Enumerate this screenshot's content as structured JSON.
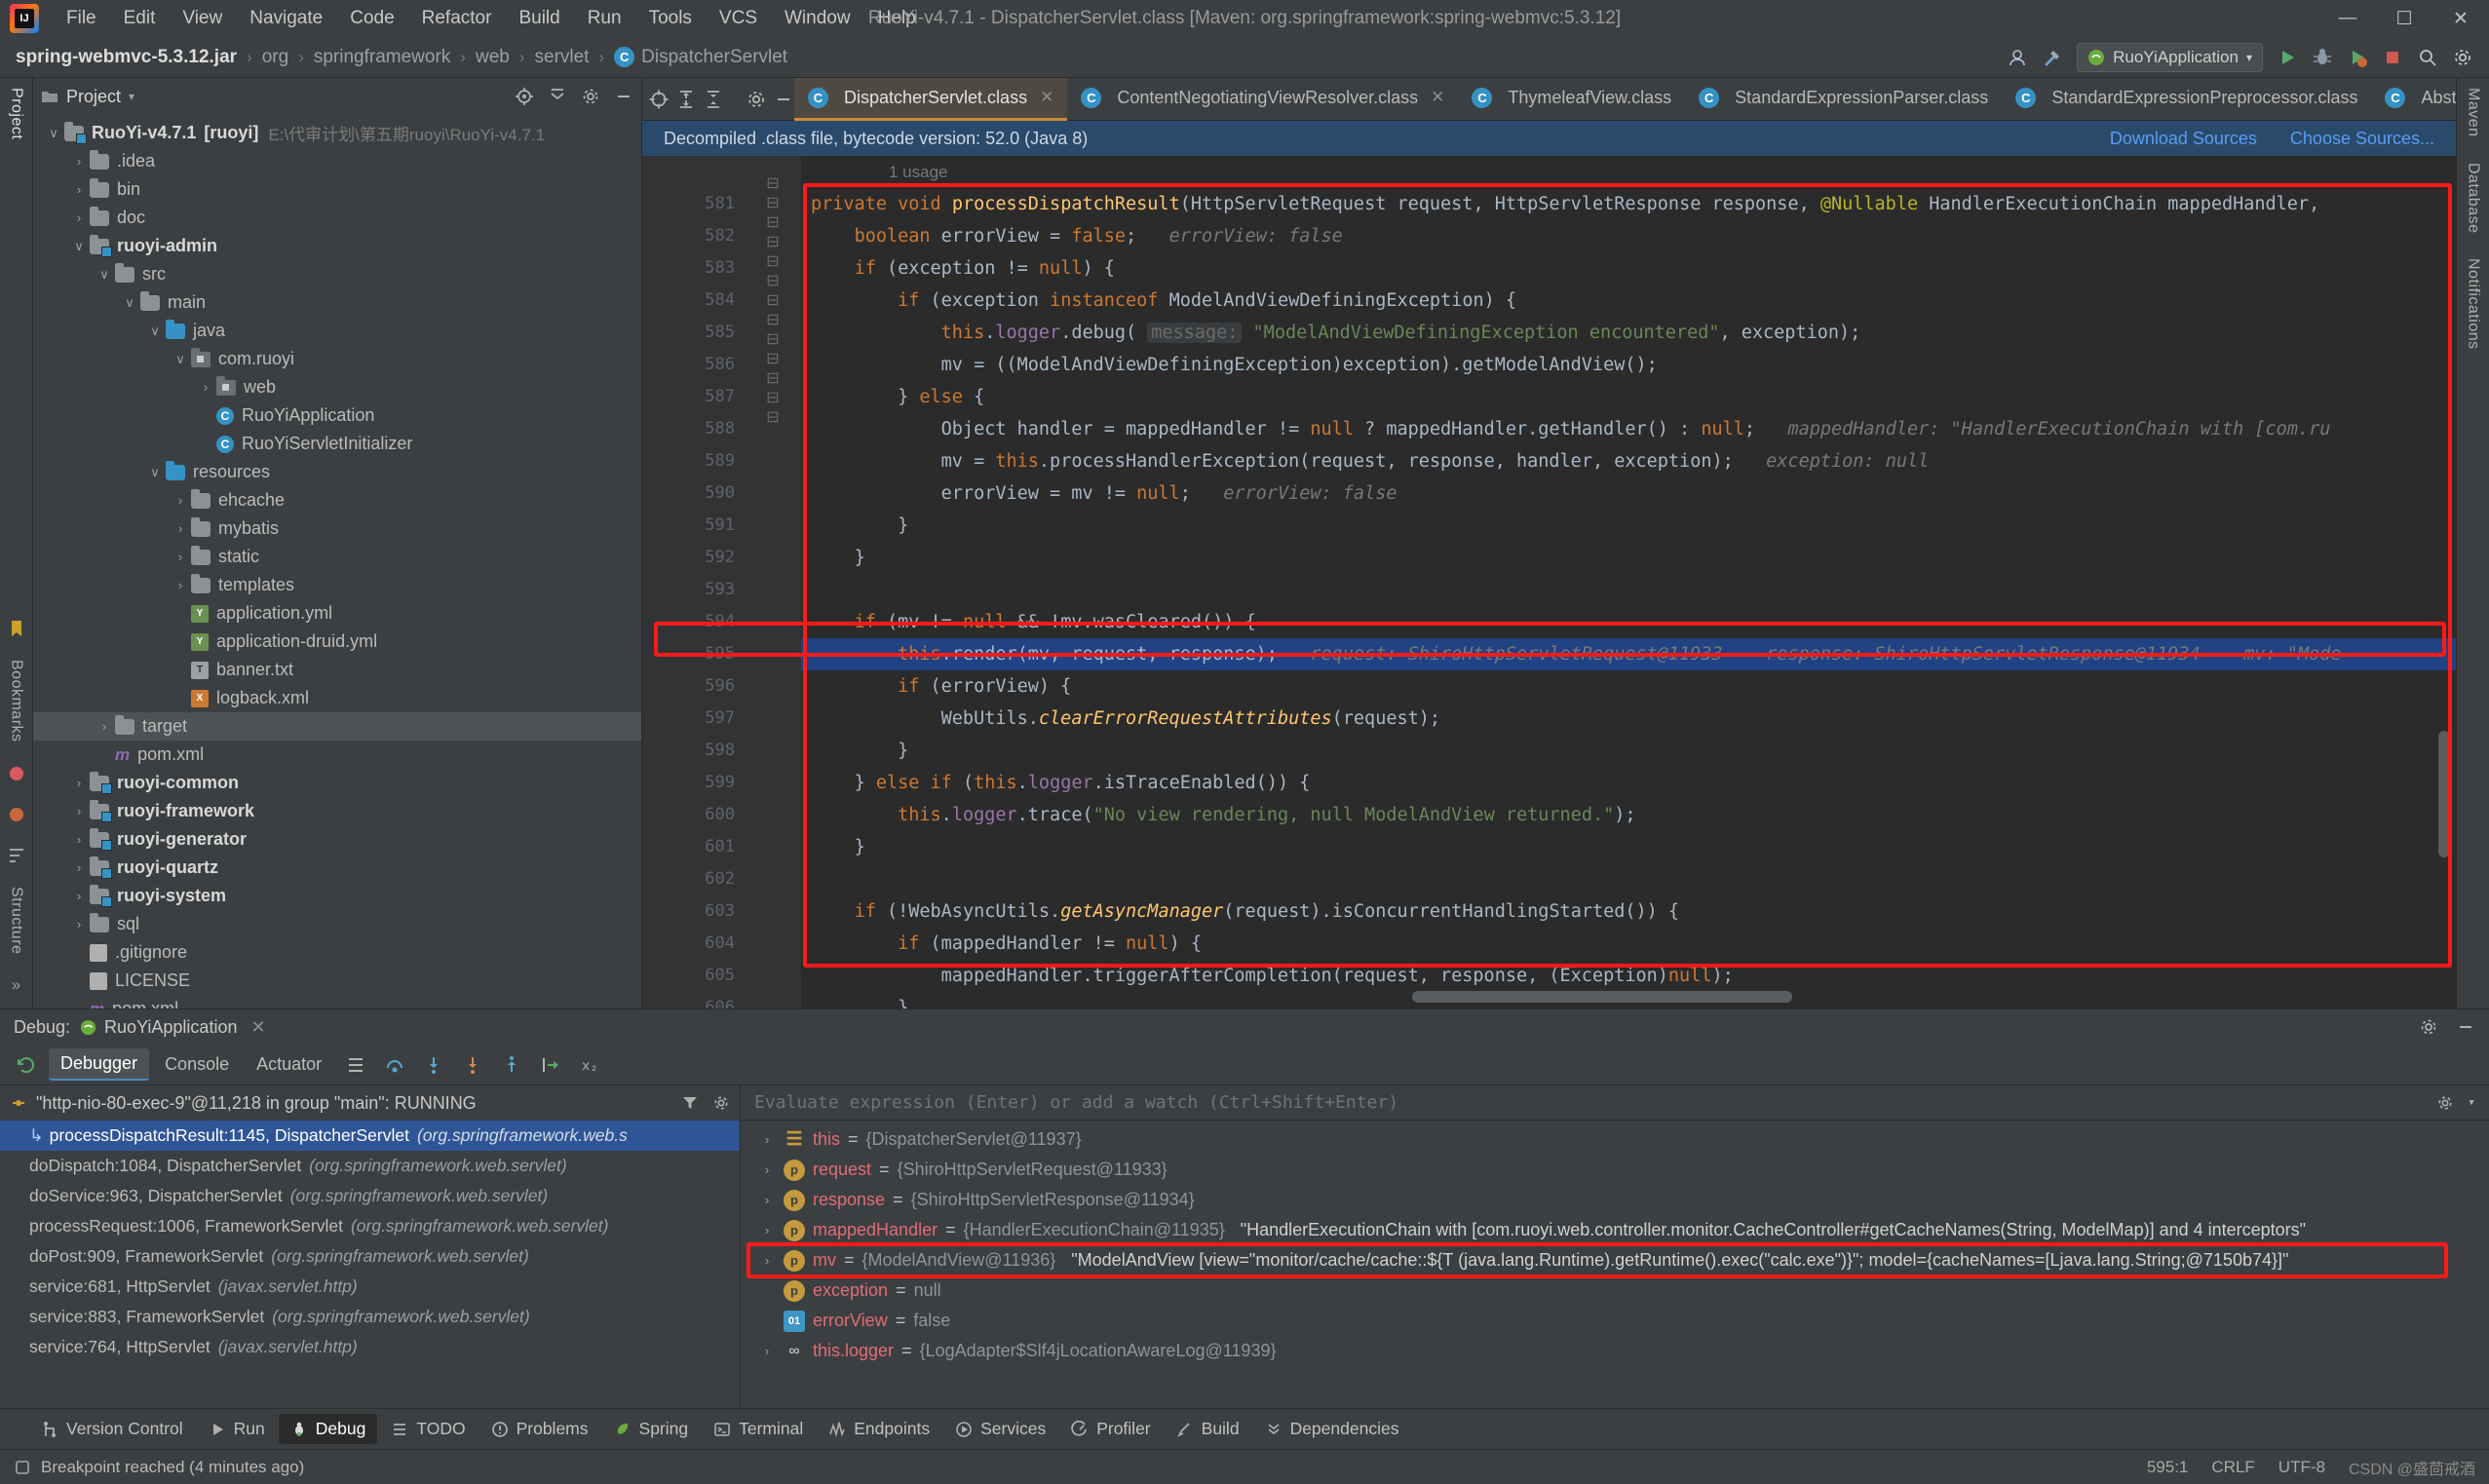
{
  "window": {
    "title": "RuoYi-v4.7.1 - DispatcherServlet.class [Maven: org.springframework:spring-webmvc:5.3.12]",
    "minimize": "—",
    "maximize": "☐",
    "close": "✕"
  },
  "menu": [
    {
      "label": "File"
    },
    {
      "label": "Edit"
    },
    {
      "label": "View"
    },
    {
      "label": "Navigate"
    },
    {
      "label": "Code"
    },
    {
      "label": "Refactor"
    },
    {
      "label": "Build"
    },
    {
      "label": "Run"
    },
    {
      "label": "Tools"
    },
    {
      "label": "VCS"
    },
    {
      "label": "Window"
    },
    {
      "label": "Help"
    }
  ],
  "breadcrumb": {
    "items": [
      "spring-webmvc-5.3.12.jar",
      "org",
      "springframework",
      "web",
      "servlet",
      "DispatcherServlet"
    ],
    "class_badge": "C",
    "separator": "›"
  },
  "navbar_right": {
    "run_config": "RuoYiApplication",
    "icons": [
      "user-icon",
      "hammer-icon",
      "run-icon",
      "debug-icon",
      "coverage-icon",
      "stop-icon",
      "search-icon",
      "settings-icon"
    ]
  },
  "left_strip": {
    "top": [
      "Project"
    ],
    "bottom": [
      "Bookmarks",
      "Structure"
    ]
  },
  "right_strip": {
    "items": [
      "Maven",
      "Database",
      "Notifications"
    ]
  },
  "project_panel": {
    "title": "Project",
    "header_icons": [
      "target-icon",
      "collapse-icon",
      "settings-icon",
      "hide-icon"
    ],
    "tree": [
      {
        "indent": 0,
        "arrow": "∨",
        "icon": "module",
        "label": "RuoYi-v4.7.1",
        "bold_suffix": "[ruoyi]",
        "path": "E:\\代审计划\\第五期ruoyi\\RuoYi-v4.7.1",
        "bold": true,
        "selected": false
      },
      {
        "indent": 1,
        "arrow": "›",
        "icon": "folder",
        "label": ".idea"
      },
      {
        "indent": 1,
        "arrow": "›",
        "icon": "folder",
        "label": "bin"
      },
      {
        "indent": 1,
        "arrow": "›",
        "icon": "folder",
        "label": "doc"
      },
      {
        "indent": 1,
        "arrow": "∨",
        "icon": "module",
        "label": "ruoyi-admin",
        "bold": true
      },
      {
        "indent": 2,
        "arrow": "∨",
        "icon": "folder",
        "label": "src"
      },
      {
        "indent": 3,
        "arrow": "∨",
        "icon": "folder",
        "label": "main"
      },
      {
        "indent": 4,
        "arrow": "∨",
        "icon": "source",
        "label": "java"
      },
      {
        "indent": 5,
        "arrow": "∨",
        "icon": "package",
        "label": "com.ruoyi"
      },
      {
        "indent": 6,
        "arrow": "›",
        "icon": "package",
        "label": "web"
      },
      {
        "indent": 6,
        "arrow": "",
        "icon": "class",
        "label": "RuoYiApplication"
      },
      {
        "indent": 6,
        "arrow": "",
        "icon": "class",
        "label": "RuoYiServletInitializer"
      },
      {
        "indent": 4,
        "arrow": "∨",
        "icon": "source",
        "label": "resources"
      },
      {
        "indent": 5,
        "arrow": "›",
        "icon": "folder",
        "label": "ehcache"
      },
      {
        "indent": 5,
        "arrow": "›",
        "icon": "folder",
        "label": "mybatis"
      },
      {
        "indent": 5,
        "arrow": "›",
        "icon": "folder",
        "label": "static"
      },
      {
        "indent": 5,
        "arrow": "›",
        "icon": "folder",
        "label": "templates"
      },
      {
        "indent": 5,
        "arrow": "",
        "icon": "yml",
        "label": "application.yml"
      },
      {
        "indent": 5,
        "arrow": "",
        "icon": "yml",
        "label": "application-druid.yml"
      },
      {
        "indent": 5,
        "arrow": "",
        "icon": "txt",
        "label": "banner.txt"
      },
      {
        "indent": 5,
        "arrow": "",
        "icon": "xml",
        "label": "logback.xml"
      },
      {
        "indent": 2,
        "arrow": "›",
        "icon": "folder",
        "label": "target",
        "selected": true
      },
      {
        "indent": 2,
        "arrow": "",
        "icon": "maven",
        "label": "pom.xml"
      },
      {
        "indent": 1,
        "arrow": "›",
        "icon": "module",
        "label": "ruoyi-common",
        "bold": true
      },
      {
        "indent": 1,
        "arrow": "›",
        "icon": "module",
        "label": "ruoyi-framework",
        "bold": true
      },
      {
        "indent": 1,
        "arrow": "›",
        "icon": "module",
        "label": "ruoyi-generator",
        "bold": true
      },
      {
        "indent": 1,
        "arrow": "›",
        "icon": "module",
        "label": "ruoyi-quartz",
        "bold": true
      },
      {
        "indent": 1,
        "arrow": "›",
        "icon": "module",
        "label": "ruoyi-system",
        "bold": true
      },
      {
        "indent": 1,
        "arrow": "›",
        "icon": "folder",
        "label": "sql"
      },
      {
        "indent": 1,
        "arrow": "",
        "icon": "file",
        "label": ".gitignore"
      },
      {
        "indent": 1,
        "arrow": "",
        "icon": "file",
        "label": "LICENSE"
      },
      {
        "indent": 1,
        "arrow": "",
        "icon": "maven",
        "label": "pom.xml"
      }
    ]
  },
  "editor": {
    "tabs": [
      {
        "label": "DispatcherServlet.class",
        "active": true,
        "closeable": true
      },
      {
        "label": "ContentNegotiatingViewResolver.class",
        "active": false,
        "closeable": true
      },
      {
        "label": "ThymeleafView.class",
        "active": false,
        "closeable": false
      },
      {
        "label": "StandardExpressionParser.class",
        "active": false,
        "closeable": false
      },
      {
        "label": "StandardExpressionPreprocessor.class",
        "active": false,
        "closeable": false
      },
      {
        "label": "Abstra",
        "active": false,
        "closeable": false
      }
    ],
    "banner": {
      "text": "Decompiled .class file, bytecode version: 52.0 (Java 8)",
      "download_sources": "Download Sources",
      "choose_sources": "Choose Sources..."
    },
    "usage_hint": "1 usage",
    "first_line_number": 581,
    "lines": [
      {
        "n": 581,
        "gut": "@",
        "fold": "⊟",
        "html": "<span class=\"kw\">private</span> <span class=\"kw\">void</span> <span class=\"fn\">processDispatchResult</span><span class=\"plain\">(HttpServletRequest request, HttpServletResponse response, </span><span class=\"ann\">@Nullable</span><span class=\"plain\"> HandlerExecutionChain mappedHandler,</span>",
        "indent": 0
      },
      {
        "n": 582,
        "html": "    <span class=\"kw\">boolean</span> <span class=\"plain\">errorView = </span><span class=\"kw\">false</span><span class=\"plain\">;</span>   <span class=\"hint\">errorView: false</span>"
      },
      {
        "n": 583,
        "fold": "⊟",
        "html": "    <span class=\"kw\">if</span> <span class=\"plain\">(exception != </span><span class=\"kw\">null</span><span class=\"plain\">) {</span>"
      },
      {
        "n": 584,
        "fold": "⊟",
        "html": "        <span class=\"kw\">if</span> <span class=\"plain\">(exception </span><span class=\"kw\">instanceof</span><span class=\"plain\"> ModelAndViewDefiningException) {</span>"
      },
      {
        "n": 585,
        "html": "            <span class=\"kw\">this</span><span class=\"plain\">.</span><span class=\"fld\">logger</span><span class=\"plain\">.debug( </span><span class=\"hintlbl\">message:</span> <span class=\"str\">\"ModelAndViewDefiningException encountered\"</span><span class=\"plain\">, exception);</span>"
      },
      {
        "n": 586,
        "html": "            <span class=\"plain\">mv = ((ModelAndViewDefiningException)exception).getModelAndView();</span>"
      },
      {
        "n": 587,
        "fold": "⊟",
        "html": "        <span class=\"plain\">} </span><span class=\"kw\">else</span> <span class=\"plain\">{</span>"
      },
      {
        "n": 588,
        "html": "            <span class=\"plain\">Object handler = mappedHandler != </span><span class=\"kw\">null</span><span class=\"plain\"> ? mappedHandler.getHandler() : </span><span class=\"kw\">null</span><span class=\"plain\">;</span>   <span class=\"hint\">mappedHandler: \"HandlerExecutionChain with [com.ru</span>"
      },
      {
        "n": 589,
        "html": "            <span class=\"plain\">mv = </span><span class=\"kw\">this</span><span class=\"plain\">.processHandlerException(request, response, handler, exception);</span>   <span class=\"hint\">exception: null</span>"
      },
      {
        "n": 590,
        "html": "            <span class=\"plain\">errorView = mv != </span><span class=\"kw\">null</span><span class=\"plain\">;</span>   <span class=\"hint\">errorView: false</span>"
      },
      {
        "n": 591,
        "fold": "⊟",
        "html": "        <span class=\"plain\">}</span>"
      },
      {
        "n": 592,
        "html": "    <span class=\"plain\">}</span>"
      },
      {
        "n": 593,
        "html": ""
      },
      {
        "n": 594,
        "fold": "⊟",
        "html": "    <span class=\"kw\">if</span> <span class=\"plain\">(mv != </span><span class=\"kw\">null</span><span class=\"plain\"> &amp;&amp; !mv.wasCleared()) {</span>"
      },
      {
        "n": 595,
        "bp": true,
        "hl": true,
        "html": "        <span class=\"kw\">this</span><span class=\"plain\">.render(mv, request, response);</span>   <span class=\"hint\">request: ShiroHttpServletRequest@11933    response: ShiroHttpServletResponse@11934    mv: \"Mode</span>"
      },
      {
        "n": 596,
        "fold": "⊟",
        "html": "        <span class=\"kw\">if</span> <span class=\"plain\">(errorView) {</span>"
      },
      {
        "n": 597,
        "html": "            <span class=\"plain\">WebUtils.</span><span class=\"fn\" style=\"font-style:italic\">clearErrorRequestAttributes</span><span class=\"plain\">(request);</span>"
      },
      {
        "n": 598,
        "fold": "⊟",
        "html": "        <span class=\"plain\">}</span>"
      },
      {
        "n": 599,
        "fold": "⊟",
        "html": "    <span class=\"plain\">} </span><span class=\"kw\">else if</span> <span class=\"plain\">(</span><span class=\"kw\">this</span><span class=\"plain\">.</span><span class=\"fld\">logger</span><span class=\"plain\">.isTraceEnabled()) {</span>"
      },
      {
        "n": 600,
        "html": "        <span class=\"kw\">this</span><span class=\"plain\">.</span><span class=\"fld\">logger</span><span class=\"plain\">.trace(</span><span class=\"str\">\"No view rendering, null ModelAndView returned.\"</span><span class=\"plain\">);</span>"
      },
      {
        "n": 601,
        "fold": "⊟",
        "html": "    <span class=\"plain\">}</span>"
      },
      {
        "n": 602,
        "html": ""
      },
      {
        "n": 603,
        "fold": "⊟",
        "html": "    <span class=\"kw\">if</span> <span class=\"plain\">(!WebAsyncUtils.</span><span class=\"fn\" style=\"font-style:italic\">getAsyncManager</span><span class=\"plain\">(request).isConcurrentHandlingStarted()) {</span>"
      },
      {
        "n": 604,
        "fold": "⊟",
        "html": "        <span class=\"kw\">if</span> <span class=\"plain\">(mappedHandler != </span><span class=\"kw\">null</span><span class=\"plain\">) {</span>"
      },
      {
        "n": 605,
        "html": "            <span class=\"plain\">mappedHandler.triggerAfterCompletion(request, response, (Exception)</span><span class=\"kw\">null</span><span class=\"plain\">);</span>"
      },
      {
        "n": 606,
        "fold": "⊟",
        "html": "        <span class=\"plain\">}</span>"
      },
      {
        "n": 607,
        "html": ""
      }
    ]
  },
  "debug": {
    "label": "Debug:",
    "session": "RuoYiApplication",
    "close": "✕",
    "tabs": [
      {
        "label": "Debugger",
        "active": true
      },
      {
        "label": "Console",
        "active": false
      },
      {
        "label": "Actuator",
        "active": false
      }
    ],
    "toolbar_icons": [
      "layout-icon",
      "mute-breakpoints-icon",
      "step-over-icon",
      "step-into-icon",
      "step-out-icon",
      "run-to-cursor-icon",
      "evaluate-icon"
    ],
    "thread": "\"http-nio-80-exec-9\"@11,218 in group \"main\": RUNNING",
    "frames": [
      {
        "text": "processDispatchResult:1145, DispatcherServlet",
        "pkg": "(org.springframework.web.s",
        "selected": true
      },
      {
        "text": "doDispatch:1084, DispatcherServlet",
        "pkg": "(org.springframework.web.servlet)"
      },
      {
        "text": "doService:963, DispatcherServlet",
        "pkg": "(org.springframework.web.servlet)"
      },
      {
        "text": "processRequest:1006, FrameworkServlet",
        "pkg": "(org.springframework.web.servlet)"
      },
      {
        "text": "doPost:909, FrameworkServlet",
        "pkg": "(org.springframework.web.servlet)"
      },
      {
        "text": "service:681, HttpServlet",
        "pkg": "(javax.servlet.http)"
      },
      {
        "text": "service:883, FrameworkServlet",
        "pkg": "(org.springframework.web.servlet)"
      },
      {
        "text": "service:764, HttpServlet",
        "pkg": "(javax.servlet.http)"
      }
    ],
    "watch_placeholder": "Evaluate expression (Enter) or add a watch (Ctrl+Shift+Enter)",
    "variables": [
      {
        "arrow": "›",
        "icon": "list",
        "name": "this",
        "eq": "=",
        "value": "{DispatcherServlet@11937}",
        "extra": ""
      },
      {
        "arrow": "›",
        "icon": "p",
        "name": "request",
        "eq": "=",
        "value": "{ShiroHttpServletRequest@11933}",
        "extra": ""
      },
      {
        "arrow": "›",
        "icon": "p",
        "name": "response",
        "eq": "=",
        "value": "{ShiroHttpServletResponse@11934}",
        "extra": ""
      },
      {
        "arrow": "›",
        "icon": "p",
        "name": "mappedHandler",
        "eq": "=",
        "value": "{HandlerExecutionChain@11935}",
        "extra": "\"HandlerExecutionChain with [com.ruoyi.web.controller.monitor.CacheController#getCacheNames(String, ModelMap)] and 4 interceptors\""
      },
      {
        "arrow": "›",
        "icon": "p",
        "name": "mv",
        "eq": "=",
        "value": "{ModelAndView@11936}",
        "extra": "\"ModelAndView [view=\"monitor/cache/cache::${T (java.lang.Runtime).getRuntime().exec(\"calc.exe\")}\"; model={cacheNames=[Ljava.lang.String;@7150b74}]\"",
        "highlighted": true
      },
      {
        "arrow": "",
        "icon": "p",
        "name": "exception",
        "eq": "=",
        "value": "null",
        "extra": ""
      },
      {
        "arrow": "",
        "icon": "b",
        "name": "errorView",
        "eq": "=",
        "value": "false",
        "extra": ""
      },
      {
        "arrow": "›",
        "icon": "oo",
        "name": "this.logger",
        "eq": "=",
        "value": "{LogAdapter$Slf4jLocationAwareLog@11939}",
        "extra": ""
      }
    ]
  },
  "bottom_tools": [
    {
      "label": "Version Control",
      "icon": "branch-icon",
      "active": false
    },
    {
      "label": "Run",
      "icon": "play-icon",
      "active": false
    },
    {
      "label": "Debug",
      "icon": "bug-icon",
      "active": true
    },
    {
      "label": "TODO",
      "icon": "todo-icon",
      "active": false
    },
    {
      "label": "Problems",
      "icon": "problems-icon",
      "active": false
    },
    {
      "label": "Spring",
      "icon": "spring-leaf-icon",
      "active": false
    },
    {
      "label": "Terminal",
      "icon": "terminal-icon",
      "active": false
    },
    {
      "label": "Endpoints",
      "icon": "endpoints-icon",
      "active": false
    },
    {
      "label": "Services",
      "icon": "services-icon",
      "active": false
    },
    {
      "label": "Profiler",
      "icon": "profiler-icon",
      "active": false
    },
    {
      "label": "Build",
      "icon": "build-icon",
      "active": false
    },
    {
      "label": "Dependencies",
      "icon": "dependencies-icon",
      "active": false
    }
  ],
  "statusbar": {
    "message": "Breakpoint reached (4 minutes ago)",
    "caret": "595:1",
    "line_sep": "CRLF",
    "encoding": "UTF-8",
    "indent": "4",
    "watermark": "CSDN @盛茴戒酒"
  }
}
